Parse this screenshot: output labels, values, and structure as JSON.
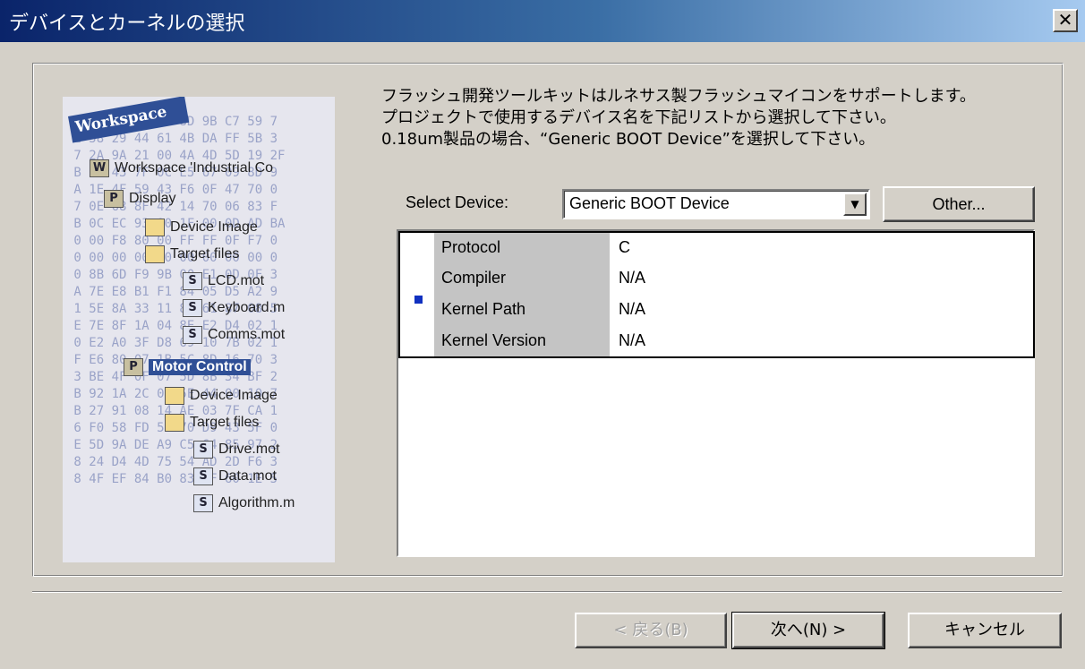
{
  "window": {
    "title": "デバイスとカーネルの選択",
    "close_label": "✕"
  },
  "description": [
    "フラッシュ開発ツールキットはルネサス製フラッシュマイコンをサポートします。",
    "プロジェクトで使用するデバイス名を下記リストから選択して下さい。",
    "0.18um製品の場合、“Generic BOOT Device”を選択して下さい。"
  ],
  "device": {
    "label": "Select Device:",
    "selected": "Generic BOOT Device",
    "other_button": "Other..."
  },
  "properties": [
    {
      "key": "Protocol",
      "value": "C"
    },
    {
      "key": "Compiler",
      "value": "N/A"
    },
    {
      "key": "Kernel Path",
      "value": "N/A"
    },
    {
      "key": "Kernel Version",
      "value": "N/A"
    }
  ],
  "illustration": {
    "workspace_label": "Workspace",
    "tree": [
      {
        "label": "Workspace 'Industrial Co",
        "icon": "workspace-icon"
      },
      {
        "label": "Display",
        "icon": "project-icon"
      },
      {
        "label": "Device Image",
        "icon": "folder-icon"
      },
      {
        "label": "Target files",
        "icon": "folder-icon"
      },
      {
        "label": "LCD.mot",
        "icon": "file-icon"
      },
      {
        "label": "Keyboard.m",
        "icon": "file-icon"
      },
      {
        "label": "Comms.mot",
        "icon": "file-icon"
      },
      {
        "label": "Motor Control",
        "icon": "project-icon"
      },
      {
        "label": "Device Image",
        "icon": "folder-icon"
      },
      {
        "label": "Target files",
        "icon": "folder-icon"
      },
      {
        "label": "Drive.mot",
        "icon": "file-icon"
      },
      {
        "label": "Data.mot",
        "icon": "file-icon"
      },
      {
        "label": "Algorithm.m",
        "icon": "file-icon"
      }
    ]
  },
  "buttons": {
    "back": "< 戻る(B)",
    "next": "次へ(N) >",
    "cancel": "キャンセル"
  },
  "colors": {
    "title_bar_start": "#0a246a",
    "title_bar_end": "#a6caf0",
    "dialog_bg": "#d4d0c8",
    "marker": "#1030c0"
  }
}
